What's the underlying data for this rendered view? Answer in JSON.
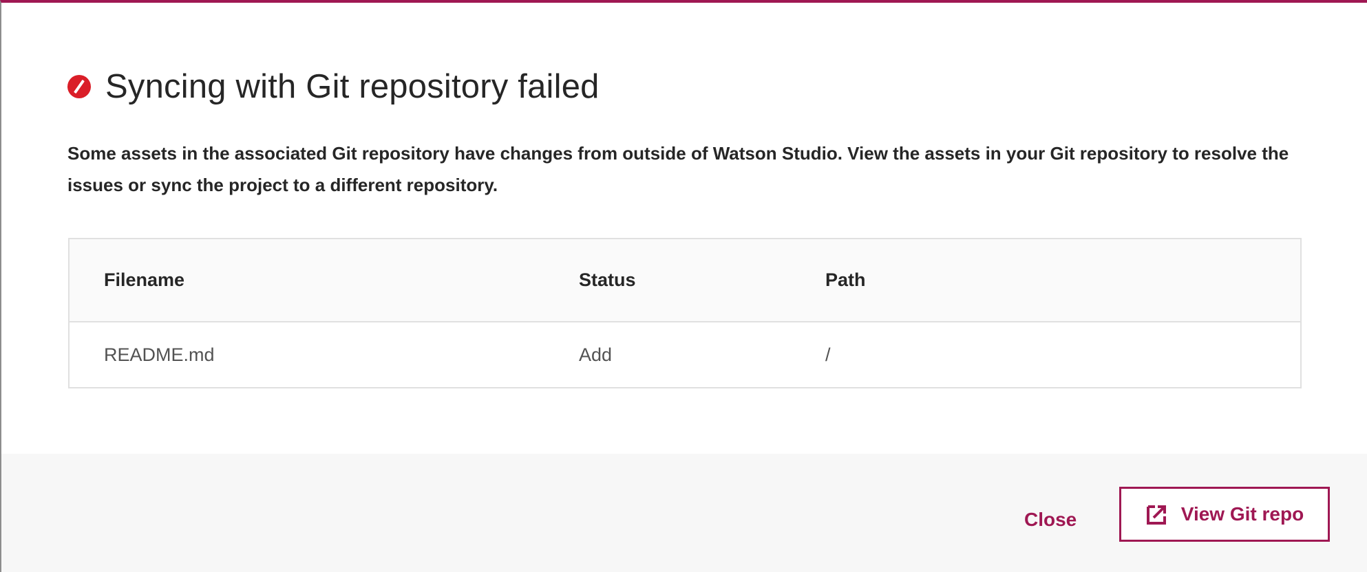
{
  "dialog": {
    "title": "Syncing with Git repository failed",
    "status_icon": "error-icon",
    "description": "Some assets in the associated Git repository have changes from outside of Watson Studio. View the assets in your Git repository to resolve the issues or sync the project to a different repository."
  },
  "table": {
    "headers": {
      "filename": "Filename",
      "status": "Status",
      "path": "Path"
    },
    "rows": [
      {
        "filename": "README.md",
        "status": "Add",
        "path": "/"
      }
    ]
  },
  "footer": {
    "close_label": "Close",
    "view_repo_label": "View Git repo",
    "view_repo_icon": "launch-icon"
  },
  "colors": {
    "accent": "#9f1853",
    "error": "#da1e28"
  }
}
